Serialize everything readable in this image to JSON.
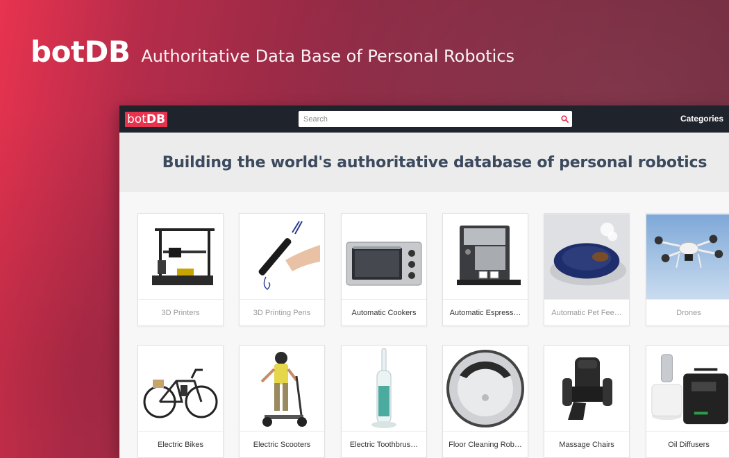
{
  "hero": {
    "logo": "botDB",
    "tagline": "Authoritative Data Base of Personal Robotics"
  },
  "nav": {
    "logo_prefix": "bot",
    "logo_bold": "DB",
    "search_placeholder": "Search",
    "categories_label": "Categories",
    "accent_color": "#e8334f"
  },
  "headline": "Building the world's authoritative database of personal robotics",
  "categories": [
    {
      "label": "3D Printers",
      "icon": "3d-printer-image",
      "muted": true
    },
    {
      "label": "3D Printing Pens",
      "icon": "3d-pen-image",
      "muted": true
    },
    {
      "label": "Automatic Cookers",
      "icon": "oven-image",
      "muted": false
    },
    {
      "label": "Automatic Espress…",
      "icon": "espresso-machine-image",
      "muted": false
    },
    {
      "label": "Automatic Pet Fee…",
      "icon": "pet-feeder-image",
      "muted": true
    },
    {
      "label": "Drones",
      "icon": "drone-image",
      "muted": true
    },
    {
      "label": "Electric Bikes",
      "icon": "ebike-image",
      "muted": false
    },
    {
      "label": "Electric Scooters",
      "icon": "scooter-image",
      "muted": false
    },
    {
      "label": "Electric Toothbrus…",
      "icon": "toothbrush-image",
      "muted": false
    },
    {
      "label": "Floor Cleaning Rob…",
      "icon": "robot-vacuum-image",
      "muted": false
    },
    {
      "label": "Massage Chairs",
      "icon": "massage-chair-image",
      "muted": false
    },
    {
      "label": "Oil Diffusers",
      "icon": "oil-diffuser-image",
      "muted": false
    }
  ]
}
